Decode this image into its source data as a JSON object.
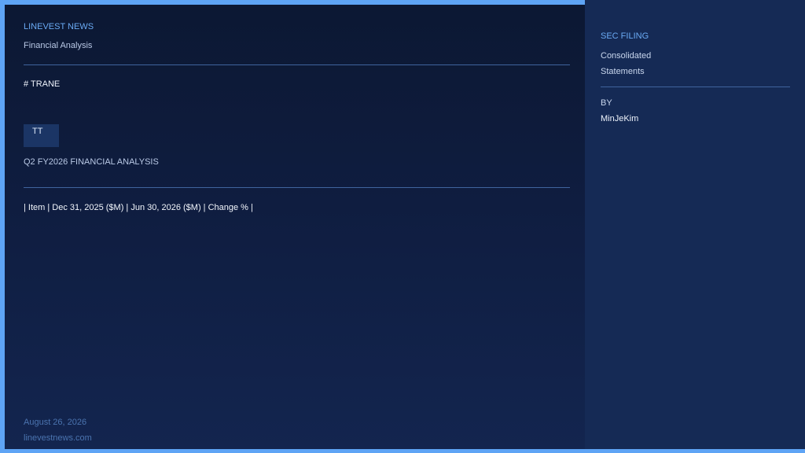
{
  "main": {
    "brand": "LINEVEST NEWS",
    "section": "Financial Analysis",
    "heading": "# TRANE",
    "ticker_badge": "TT",
    "analysis_title": "Q2 FY2026 FINANCIAL ANALYSIS",
    "table_header": "| Item | Dec 31, 2025 ($M) | Jun 30, 2026 ($M) | Change % |",
    "date": "August 26, 2026",
    "site": "linevestnews.com"
  },
  "sidebar": {
    "filing_label": "SEC FILING",
    "filing_line_1": "Consolidated",
    "filing_line_2": "Statements",
    "by_label": "BY",
    "author": "MinJeKim"
  },
  "colors": {
    "frame": "#5ea4f5",
    "main_bg": "#0f1d40",
    "side_bg": "#152a55",
    "accent": "#6aaaf4"
  }
}
